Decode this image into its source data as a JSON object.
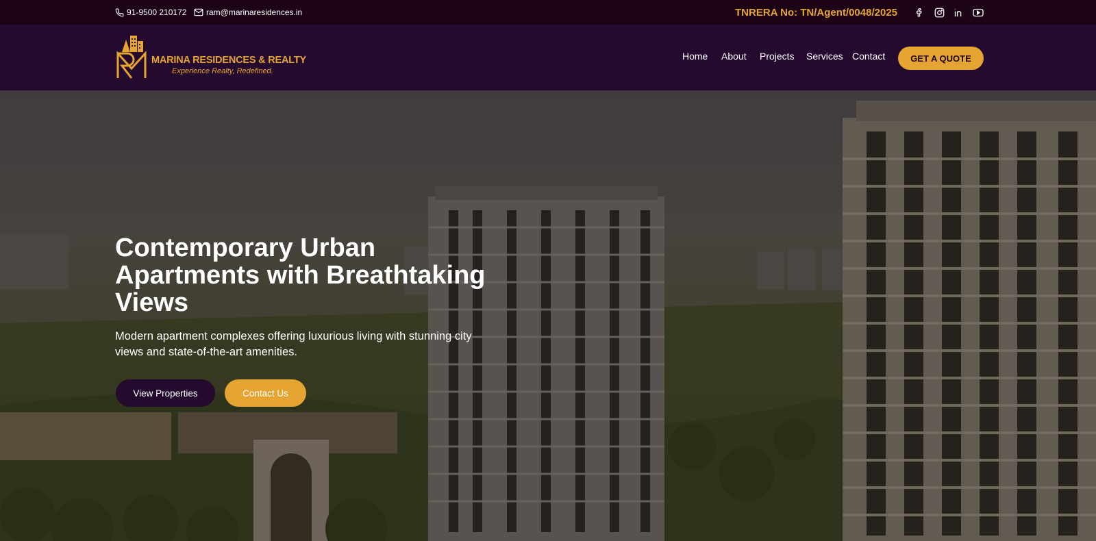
{
  "topbar": {
    "phone": "91-9500 210172",
    "email": "ram@marinaresidences.in",
    "rera": "TNRERA No: TN/Agent/0048/2025",
    "socials": [
      "facebook-icon",
      "instagram-icon",
      "linkedin-icon",
      "youtube-icon"
    ]
  },
  "header": {
    "logo_title": "MARINA RESIDENCES & REALTY",
    "logo_tagline": "Experience Realty, Redefined.",
    "nav": [
      "Home",
      "About",
      "Projects",
      "Services",
      "Contact"
    ],
    "cta": "GET A QUOTE"
  },
  "hero": {
    "title": "Contemporary Urban Apartments with Breathtaking Views",
    "subtitle": "Modern apartment complexes offering luxurious living with stunning city views and state-of-the-art amenities.",
    "primary_button": "View Properties",
    "secondary_button": "Contact Us"
  },
  "colors": {
    "topbar_bg": "#1c0416",
    "header_bg": "#230a2e",
    "accent": "#e6a532",
    "white": "#ffffff"
  }
}
